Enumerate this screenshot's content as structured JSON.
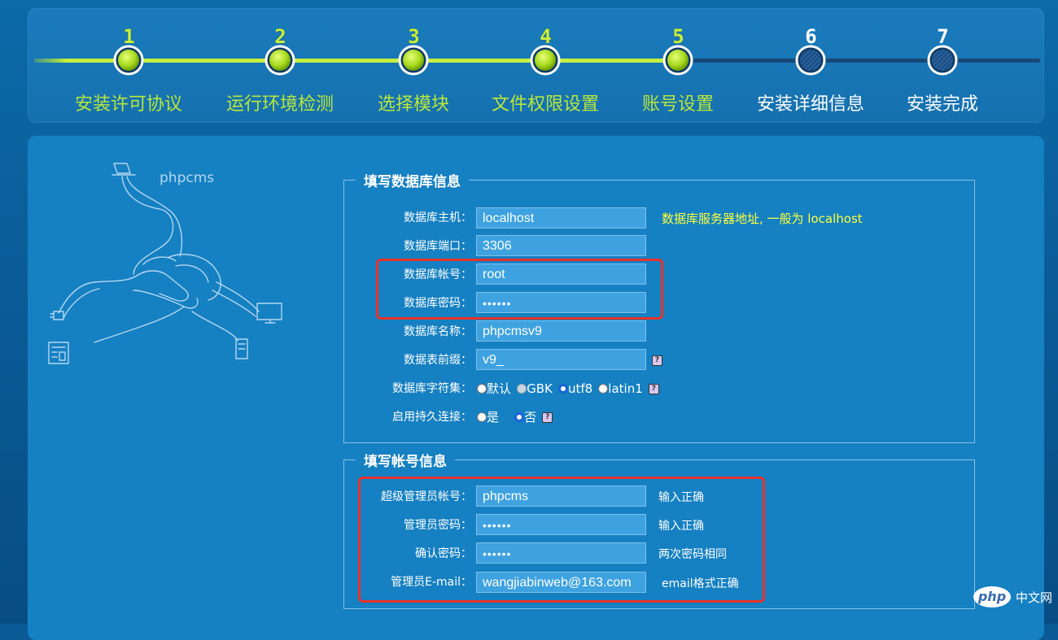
{
  "steps": [
    {
      "num": "1",
      "label": "安装许可协议",
      "done": true
    },
    {
      "num": "2",
      "label": "运行环境检测",
      "done": true
    },
    {
      "num": "3",
      "label": "选择模块",
      "done": true
    },
    {
      "num": "4",
      "label": "文件权限设置",
      "done": true
    },
    {
      "num": "5",
      "label": "账号设置",
      "done": true
    },
    {
      "num": "6",
      "label": "安装详细信息",
      "done": false
    },
    {
      "num": "7",
      "label": "安装完成",
      "done": false
    }
  ],
  "logo_text": "phpcms",
  "db_section": {
    "legend": "填写数据库信息",
    "host_label": "数据库主机：",
    "host_value": "localhost",
    "host_hint": "数据库服务器地址, 一般为 localhost",
    "port_label": "数据库端口：",
    "port_value": "3306",
    "user_label": "数据库帐号：",
    "user_value": "root",
    "password_label": "数据库密码：",
    "password_value": "••••••",
    "name_label": "数据库名称：",
    "name_value": "phpcmsv9",
    "prefix_label": "数据表前缀：",
    "prefix_value": "v9_",
    "charset_label": "数据库字符集：",
    "charset_options": [
      "默认",
      "GBK",
      "utf8",
      "latin1"
    ],
    "charset_selected": "utf8",
    "persist_label": "启用持久连接：",
    "persist_options": [
      "是",
      "否"
    ],
    "persist_selected": "否",
    "help_glyph": "?"
  },
  "account_section": {
    "legend": "填写帐号信息",
    "admin_label": "超级管理员帐号：",
    "admin_value": "phpcms",
    "admin_hint": "输入正确",
    "pwd_label": "管理员密码：",
    "pwd_value": "••••••",
    "pwd_hint": "输入正确",
    "confirm_label": "确认密码：",
    "confirm_value": "••••••",
    "confirm_hint": "两次密码相同",
    "email_label": "管理员E-mail：",
    "email_value": "wangjiabinweb@163.com",
    "email_hint": "email格式正确"
  },
  "watermark": {
    "logo": "php",
    "text": "中文网"
  },
  "colors": {
    "done": "#b8e83a",
    "todo": "#ffffff",
    "highlight": "#e8322a",
    "hint": "#ffff3c"
  }
}
